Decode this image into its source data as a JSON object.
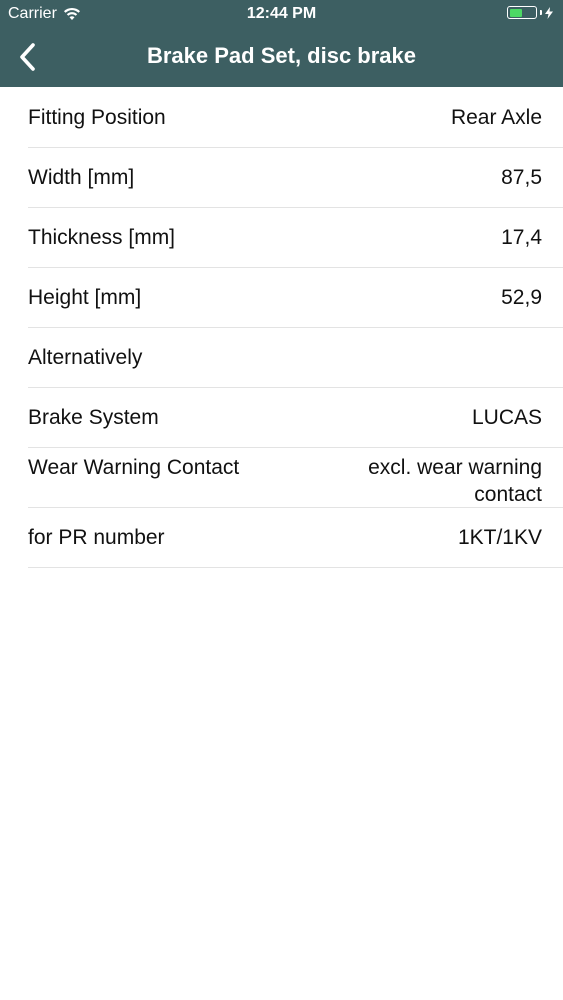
{
  "status_bar": {
    "carrier": "Carrier",
    "time": "12:44 PM",
    "battery_level": 0.5,
    "battery_color": "#4cd964"
  },
  "nav": {
    "title": "Brake Pad Set, disc brake",
    "back_icon": "chevron-left-icon",
    "background_color": "#3d5f62"
  },
  "rows": [
    {
      "label": "Fitting Position",
      "value": "Rear Axle"
    },
    {
      "label": "Width [mm]",
      "value": "87,5"
    },
    {
      "label": "Thickness [mm]",
      "value": "17,4"
    },
    {
      "label": "Height [mm]",
      "value": "52,9"
    },
    {
      "label": "Alternatively",
      "value": ""
    },
    {
      "label": "Brake System",
      "value": "LUCAS"
    },
    {
      "label": "Wear Warning Contact",
      "value": "excl. wear warning contact"
    },
    {
      "label": "for PR number",
      "value": "1KT/1KV"
    }
  ]
}
